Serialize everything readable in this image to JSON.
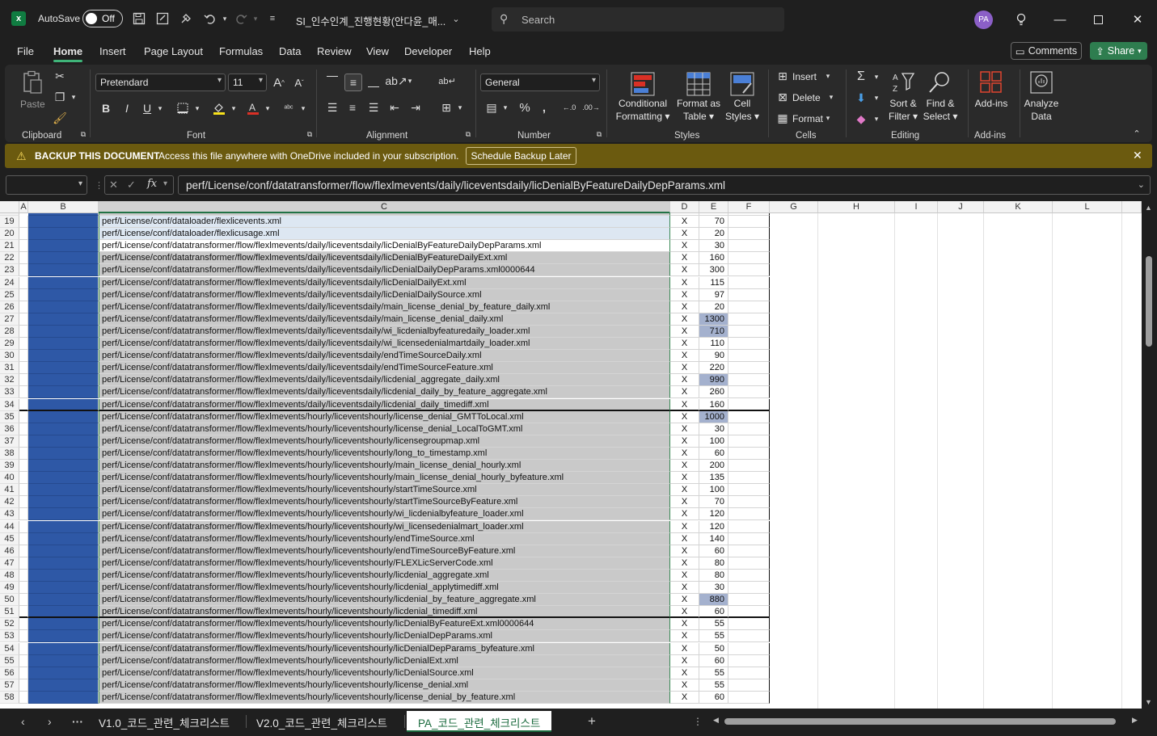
{
  "app": {
    "autosave_label": "AutoSave",
    "autosave_state": "Off",
    "doc_title": "SI_인수인계_진행현황(안다윤_매...",
    "search_placeholder": "Search",
    "avatar_initials": "PA",
    "logo_letter": "x"
  },
  "menu": {
    "tabs": [
      "File",
      "Home",
      "Insert",
      "Page Layout",
      "Formulas",
      "Data",
      "Review",
      "View",
      "Developer",
      "Help"
    ],
    "comments_label": "Comments",
    "share_label": "Share"
  },
  "ribbon": {
    "paste_label": "Paste",
    "font_name": "Pretendard",
    "font_size": "11",
    "number_format": "General",
    "conditional_formatting": [
      "Conditional",
      "Formatting"
    ],
    "format_as_table": [
      "Format as",
      "Table"
    ],
    "cell_styles": [
      "Cell",
      "Styles"
    ],
    "insert_label": "Insert",
    "delete_label": "Delete",
    "format_label": "Format",
    "sort_filter": [
      "Sort &",
      "Filter"
    ],
    "find_select": [
      "Find &",
      "Select"
    ],
    "addins_label": "Add-ins",
    "analyze_data": [
      "Analyze",
      "Data"
    ],
    "groups": [
      "Clipboard",
      "Font",
      "Alignment",
      "Number",
      "Styles",
      "Cells",
      "Editing",
      "Add-ins"
    ]
  },
  "notification": {
    "title": "BACKUP THIS DOCUMENT",
    "message": "Access this file anywhere with OneDrive included in your subscription.",
    "button": "Schedule Backup Later"
  },
  "formula_bar": {
    "name_box": "",
    "fx": "fx",
    "content": "perf/License/conf/datatransformer/flow/flexlmevents/daily/liceventsdaily/licDenialByFeatureDailyDepParams.xml"
  },
  "columns": [
    "A",
    "B",
    "C",
    "D",
    "E",
    "F",
    "G",
    "H",
    "I",
    "J",
    "K",
    "L"
  ],
  "rows": [
    {
      "n": "19",
      "c": "perf/License/conf/dataloader/flexlicevents.xml",
      "d": "X",
      "e": "70",
      "style": "light"
    },
    {
      "n": "20",
      "c": "perf/License/conf/dataloader/flexlicusage.xml",
      "d": "X",
      "e": "20",
      "style": "light"
    },
    {
      "n": "21",
      "c": "perf/License/conf/datatransformer/flow/flexlmevents/daily/liceventsdaily/licDenialByFeatureDailyDepParams.xml",
      "d": "X",
      "e": "30",
      "style": "white"
    },
    {
      "n": "22",
      "c": "perf/License/conf/datatransformer/flow/flexlmevents/daily/liceventsdaily/licDenialByFeatureDailyExt.xml",
      "d": "X",
      "e": "160"
    },
    {
      "n": "23",
      "c": "perf/License/conf/datatransformer/flow/flexlmevents/daily/liceventsdaily/licDenialDailyDepParams.xml0000644",
      "d": "X",
      "e": "300"
    },
    {
      "n": "24",
      "c": "perf/License/conf/datatransformer/flow/flexlmevents/daily/liceventsdaily/licDenialDailyExt.xml",
      "d": "X",
      "e": "115"
    },
    {
      "n": "25",
      "c": "perf/License/conf/datatransformer/flow/flexlmevents/daily/liceventsdaily/licDenialDailySource.xml",
      "d": "X",
      "e": "97"
    },
    {
      "n": "26",
      "c": "perf/License/conf/datatransformer/flow/flexlmevents/daily/liceventsdaily/main_license_denial_by_feature_daily.xml",
      "d": "X",
      "e": "20"
    },
    {
      "n": "27",
      "c": "perf/License/conf/datatransformer/flow/flexlmevents/daily/liceventsdaily/main_license_denial_daily.xml",
      "d": "X",
      "e": "1300",
      "hl": true
    },
    {
      "n": "28",
      "c": "perf/License/conf/datatransformer/flow/flexlmevents/daily/liceventsdaily/wi_licdenialbyfeaturedaily_loader.xml",
      "d": "X",
      "e": "710",
      "hl": true
    },
    {
      "n": "29",
      "c": "perf/License/conf/datatransformer/flow/flexlmevents/daily/liceventsdaily/wi_licensedenialmartdaily_loader.xml",
      "d": "X",
      "e": "110"
    },
    {
      "n": "30",
      "c": "perf/License/conf/datatransformer/flow/flexlmevents/daily/liceventsdaily/endTimeSourceDaily.xml",
      "d": "X",
      "e": "90"
    },
    {
      "n": "31",
      "c": "perf/License/conf/datatransformer/flow/flexlmevents/daily/liceventsdaily/endTimeSourceFeature.xml",
      "d": "X",
      "e": "220"
    },
    {
      "n": "32",
      "c": "perf/License/conf/datatransformer/flow/flexlmevents/daily/liceventsdaily/licdenial_aggregate_daily.xml",
      "d": "X",
      "e": "990",
      "hl": true
    },
    {
      "n": "33",
      "c": "perf/License/conf/datatransformer/flow/flexlmevents/daily/liceventsdaily/licdenial_daily_by_feature_aggregate.xml",
      "d": "X",
      "e": "260"
    },
    {
      "n": "34",
      "c": "perf/License/conf/datatransformer/flow/flexlmevents/daily/liceventsdaily/licdenial_daily_timediff.xml",
      "d": "X",
      "e": "160",
      "thick": true
    },
    {
      "n": "35",
      "c": "perf/License/conf/datatransformer/flow/flexlmevents/hourly/liceventshourly/license_denial_GMTToLocal.xml",
      "d": "X",
      "e": "1000",
      "hl": true
    },
    {
      "n": "36",
      "c": "perf/License/conf/datatransformer/flow/flexlmevents/hourly/liceventshourly/license_denial_LocalToGMT.xml",
      "d": "X",
      "e": "30"
    },
    {
      "n": "37",
      "c": "perf/License/conf/datatransformer/flow/flexlmevents/hourly/liceventshourly/licensegroupmap.xml",
      "d": "X",
      "e": "100"
    },
    {
      "n": "38",
      "c": "perf/License/conf/datatransformer/flow/flexlmevents/hourly/liceventshourly/long_to_timestamp.xml",
      "d": "X",
      "e": "60"
    },
    {
      "n": "39",
      "c": "perf/License/conf/datatransformer/flow/flexlmevents/hourly/liceventshourly/main_license_denial_hourly.xml",
      "d": "X",
      "e": "200"
    },
    {
      "n": "40",
      "c": "perf/License/conf/datatransformer/flow/flexlmevents/hourly/liceventshourly/main_license_denial_hourly_byfeature.xml",
      "d": "X",
      "e": "135"
    },
    {
      "n": "41",
      "c": "perf/License/conf/datatransformer/flow/flexlmevents/hourly/liceventshourly/startTimeSource.xml",
      "d": "X",
      "e": "100"
    },
    {
      "n": "42",
      "c": "perf/License/conf/datatransformer/flow/flexlmevents/hourly/liceventshourly/startTimeSourceByFeature.xml",
      "d": "X",
      "e": "70"
    },
    {
      "n": "43",
      "c": "perf/License/conf/datatransformer/flow/flexlmevents/hourly/liceventshourly/wi_licdenialbyfeature_loader.xml",
      "d": "X",
      "e": "120"
    },
    {
      "n": "44",
      "c": "perf/License/conf/datatransformer/flow/flexlmevents/hourly/liceventshourly/wi_licensedenialmart_loader.xml",
      "d": "X",
      "e": "120"
    },
    {
      "n": "45",
      "c": "perf/License/conf/datatransformer/flow/flexlmevents/hourly/liceventshourly/endTimeSource.xml",
      "d": "X",
      "e": "140"
    },
    {
      "n": "46",
      "c": "perf/License/conf/datatransformer/flow/flexlmevents/hourly/liceventshourly/endTimeSourceByFeature.xml",
      "d": "X",
      "e": "60"
    },
    {
      "n": "47",
      "c": "perf/License/conf/datatransformer/flow/flexlmevents/hourly/liceventshourly/FLEXLicServerCode.xml",
      "d": "X",
      "e": "80"
    },
    {
      "n": "48",
      "c": "perf/License/conf/datatransformer/flow/flexlmevents/hourly/liceventshourly/licdenial_aggregate.xml",
      "d": "X",
      "e": "80"
    },
    {
      "n": "49",
      "c": "perf/License/conf/datatransformer/flow/flexlmevents/hourly/liceventshourly/licdenial_applytimediff.xml",
      "d": "X",
      "e": "30"
    },
    {
      "n": "50",
      "c": "perf/License/conf/datatransformer/flow/flexlmevents/hourly/liceventshourly/licdenial_by_feature_aggregate.xml",
      "d": "X",
      "e": "880",
      "hl": true
    },
    {
      "n": "51",
      "c": "perf/License/conf/datatransformer/flow/flexlmevents/hourly/liceventshourly/licdenial_timediff.xml",
      "d": "X",
      "e": "60",
      "thick": true
    },
    {
      "n": "52",
      "c": "perf/License/conf/datatransformer/flow/flexlmevents/hourly/liceventshourly/licDenialByFeatureExt.xml0000644",
      "d": "X",
      "e": "55"
    },
    {
      "n": "53",
      "c": "perf/License/conf/datatransformer/flow/flexlmevents/hourly/liceventshourly/licDenialDepParams.xml",
      "d": "X",
      "e": "55"
    },
    {
      "n": "54",
      "c": "perf/License/conf/datatransformer/flow/flexlmevents/hourly/liceventshourly/licDenialDepParams_byfeature.xml",
      "d": "X",
      "e": "50"
    },
    {
      "n": "55",
      "c": "perf/License/conf/datatransformer/flow/flexlmevents/hourly/liceventshourly/licDenialExt.xml",
      "d": "X",
      "e": "60"
    },
    {
      "n": "56",
      "c": "perf/License/conf/datatransformer/flow/flexlmevents/hourly/liceventshourly/licDenialSource.xml",
      "d": "X",
      "e": "55"
    },
    {
      "n": "57",
      "c": "perf/License/conf/datatransformer/flow/flexlmevents/hourly/liceventshourly/license_denial.xml",
      "d": "X",
      "e": "55"
    },
    {
      "n": "58",
      "c": "perf/License/conf/datatransformer/flow/flexlmevents/hourly/liceventshourly/license_denial_by_feature.xml",
      "d": "X",
      "e": "60"
    }
  ],
  "sheets": [
    "V1.0_코드_관련_체크리스트",
    "V2.0_코드_관련_체크리스트",
    "PA_코드_관련_체크리스트"
  ],
  "active_sheet_index": 2,
  "colors": {
    "accent_green": "#217346",
    "fill_blue": "#2e58a6",
    "fill_grey": "#c9c9c9",
    "highlight": "#a4b1ce",
    "notification": "#6b5a0f"
  }
}
